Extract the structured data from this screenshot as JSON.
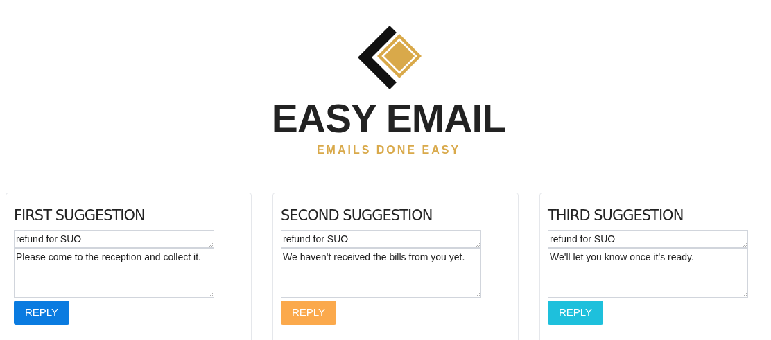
{
  "logo": {
    "title": "EASY EMAIL",
    "tagline": "EMAILS DONE EASY"
  },
  "suggestions": [
    {
      "heading": "FIRST SUGGESTION",
      "subject": "refund for SUO",
      "message": "Please come to the reception and collect it.",
      "button": "REPLY",
      "color": "#0a7be0"
    },
    {
      "heading": "SECOND SUGGESTION",
      "subject": "refund for SUO",
      "message": "We haven't received the bills from you yet.",
      "button": "REPLY",
      "color": "#fba94c"
    },
    {
      "heading": "THIRD SUGGESTION",
      "subject": "refund for SUO",
      "message": "We'll let you know once it's ready.",
      "button": "REPLY",
      "color": "#1ec0dc"
    }
  ]
}
